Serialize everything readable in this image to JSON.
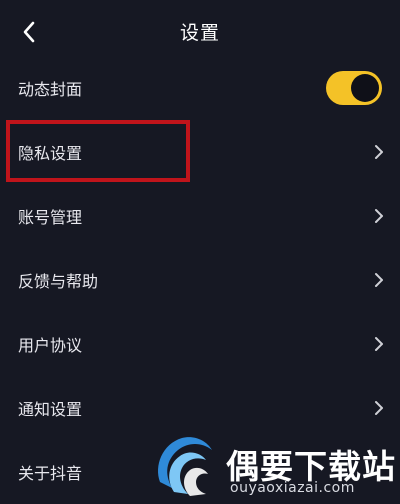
{
  "header": {
    "title": "设置",
    "back_icon": "chevron-left-icon"
  },
  "settings": [
    {
      "label": "动态封面",
      "control": "toggle",
      "toggle_on": true
    },
    {
      "label": "隐私设置",
      "control": "chevron",
      "highlighted": true
    },
    {
      "label": "账号管理",
      "control": "chevron"
    },
    {
      "label": "反馈与帮助",
      "control": "chevron"
    },
    {
      "label": "用户协议",
      "control": "chevron"
    },
    {
      "label": "通知设置",
      "control": "chevron"
    },
    {
      "label": "关于抖音",
      "control": "chevron"
    }
  ],
  "watermark": {
    "name": "偶要下载站",
    "url": "ouyaoxiazai.com"
  },
  "colors": {
    "background": "#161823",
    "toggle_on": "#f4c227",
    "highlight": "#c0141b"
  }
}
